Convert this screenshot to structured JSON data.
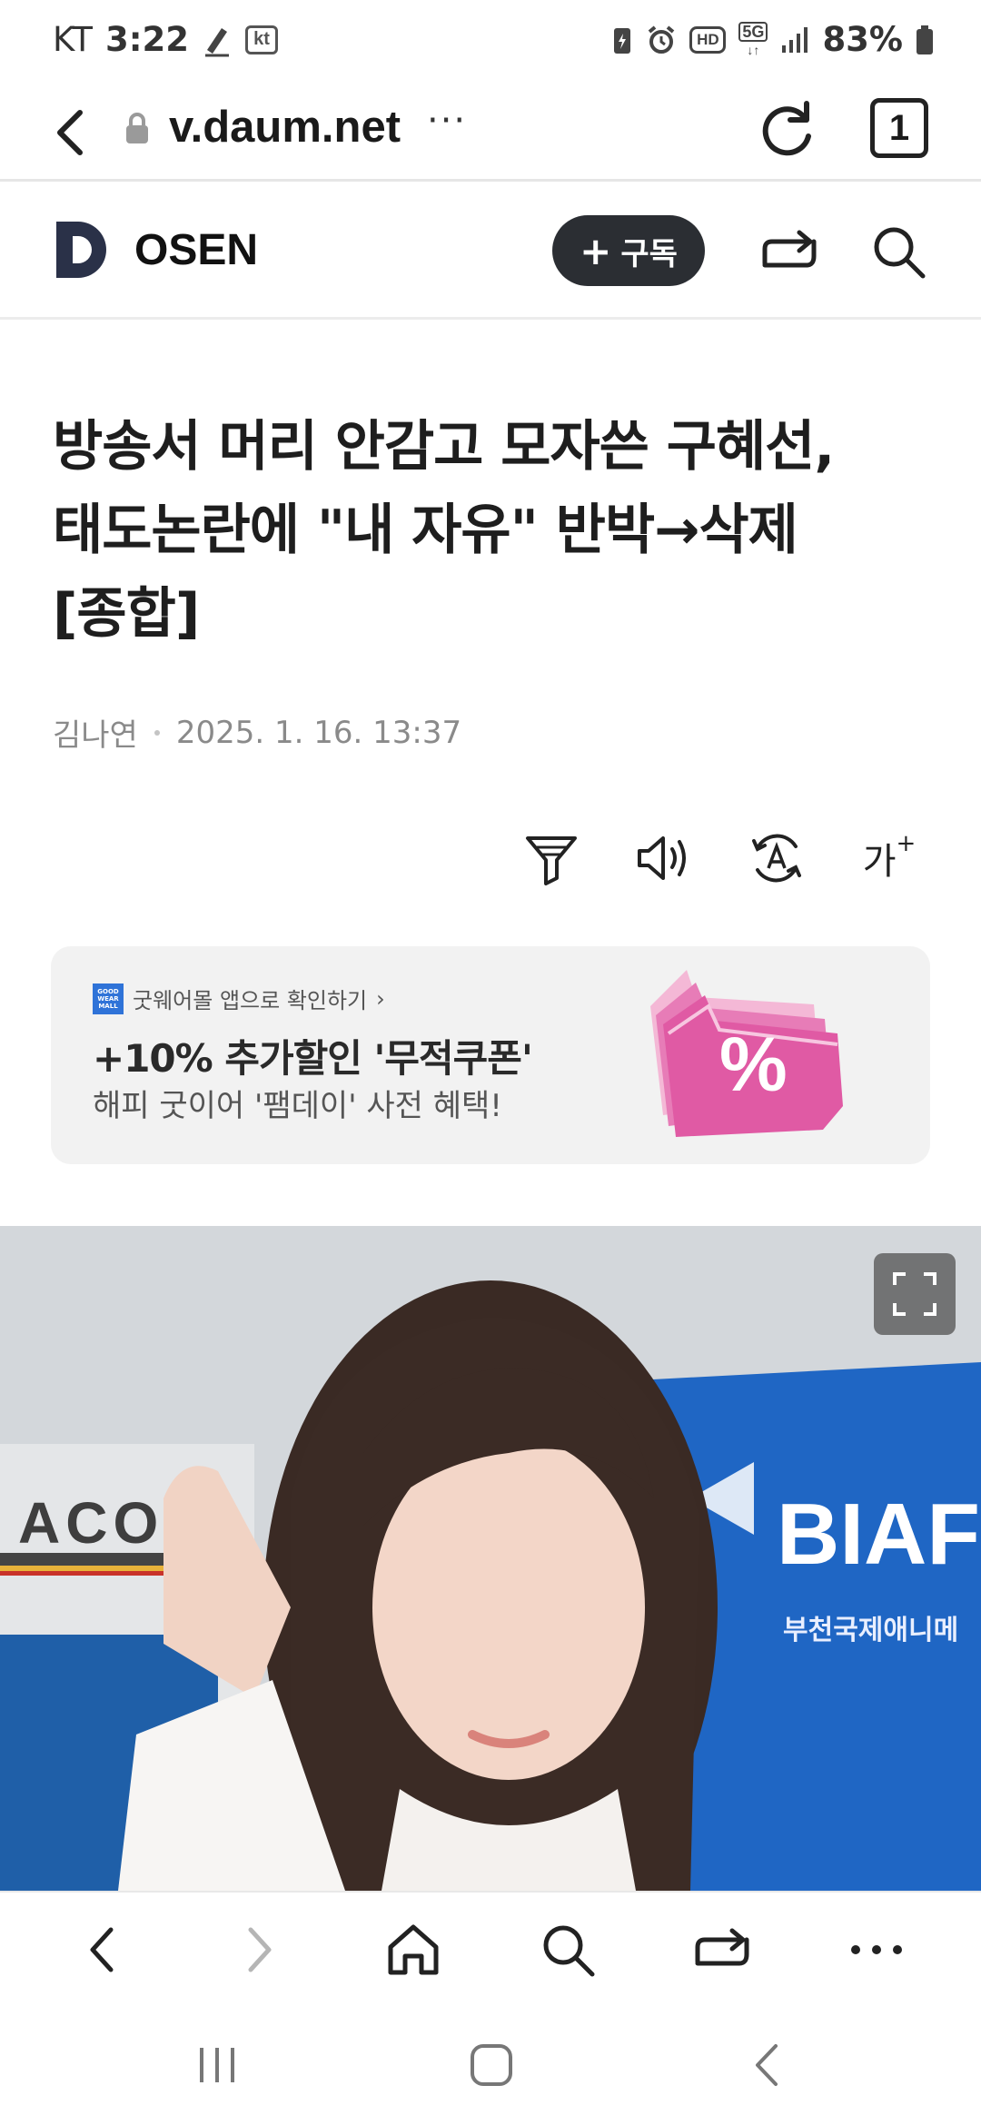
{
  "status_bar": {
    "carrier": "KT",
    "time": "3:22",
    "carrier_badge": "kt",
    "battery": "83%",
    "network_hd": "HD",
    "network_5g": "5G"
  },
  "address_bar": {
    "url": "v.daum.net",
    "more": "···",
    "tab_count": "1"
  },
  "site_header": {
    "logo_letter": "D",
    "publisher": "OSEN",
    "subscribe_plus": "+",
    "subscribe_label": "구독"
  },
  "article": {
    "headline_lines": [
      "방송서 머리 안감고 모자쓴 구혜선,",
      "태도논란에 \"내 자유\" 반박→삭제",
      "[종합]"
    ],
    "author": "김나연",
    "date": "2025. 1. 16. 13:37",
    "font_size_tool": "가"
  },
  "ad": {
    "brand_logo": "GOOD WEAR MALL",
    "top_line": "굿웨어몰 앱으로 확인하기",
    "top_chevron": "›",
    "title": "+10% 추가할인 '무적쿠폰'",
    "subtitle": "해피 굿이어 '팸데이' 사전 혜택!",
    "coupon_symbol": "%"
  },
  "hero_image": {
    "backdrop_text_left": "ACO",
    "backdrop_text_right": "BIAF",
    "backdrop_subtext_right": "부천국제애니메"
  },
  "colors": {
    "accent_dark": "#2b2e33",
    "ad_background": "#f2f2f2",
    "coupon_pink": "#e05aa4",
    "logo_navy": "#2a3148"
  },
  "icons": {
    "address_bar": [
      "back-arrow-icon",
      "lock-icon",
      "reload-icon",
      "tabs-icon"
    ],
    "site_header": [
      "share-icon",
      "search-icon"
    ],
    "article_tools": [
      "summary-filter-icon",
      "speaker-icon",
      "translate-icon",
      "font-size-icon"
    ],
    "bottom_bar": [
      "back-icon",
      "forward-icon",
      "home-icon",
      "search-icon",
      "share-icon",
      "more-icon"
    ],
    "system_nav": [
      "recents-icon",
      "home-icon",
      "back-icon"
    ]
  }
}
